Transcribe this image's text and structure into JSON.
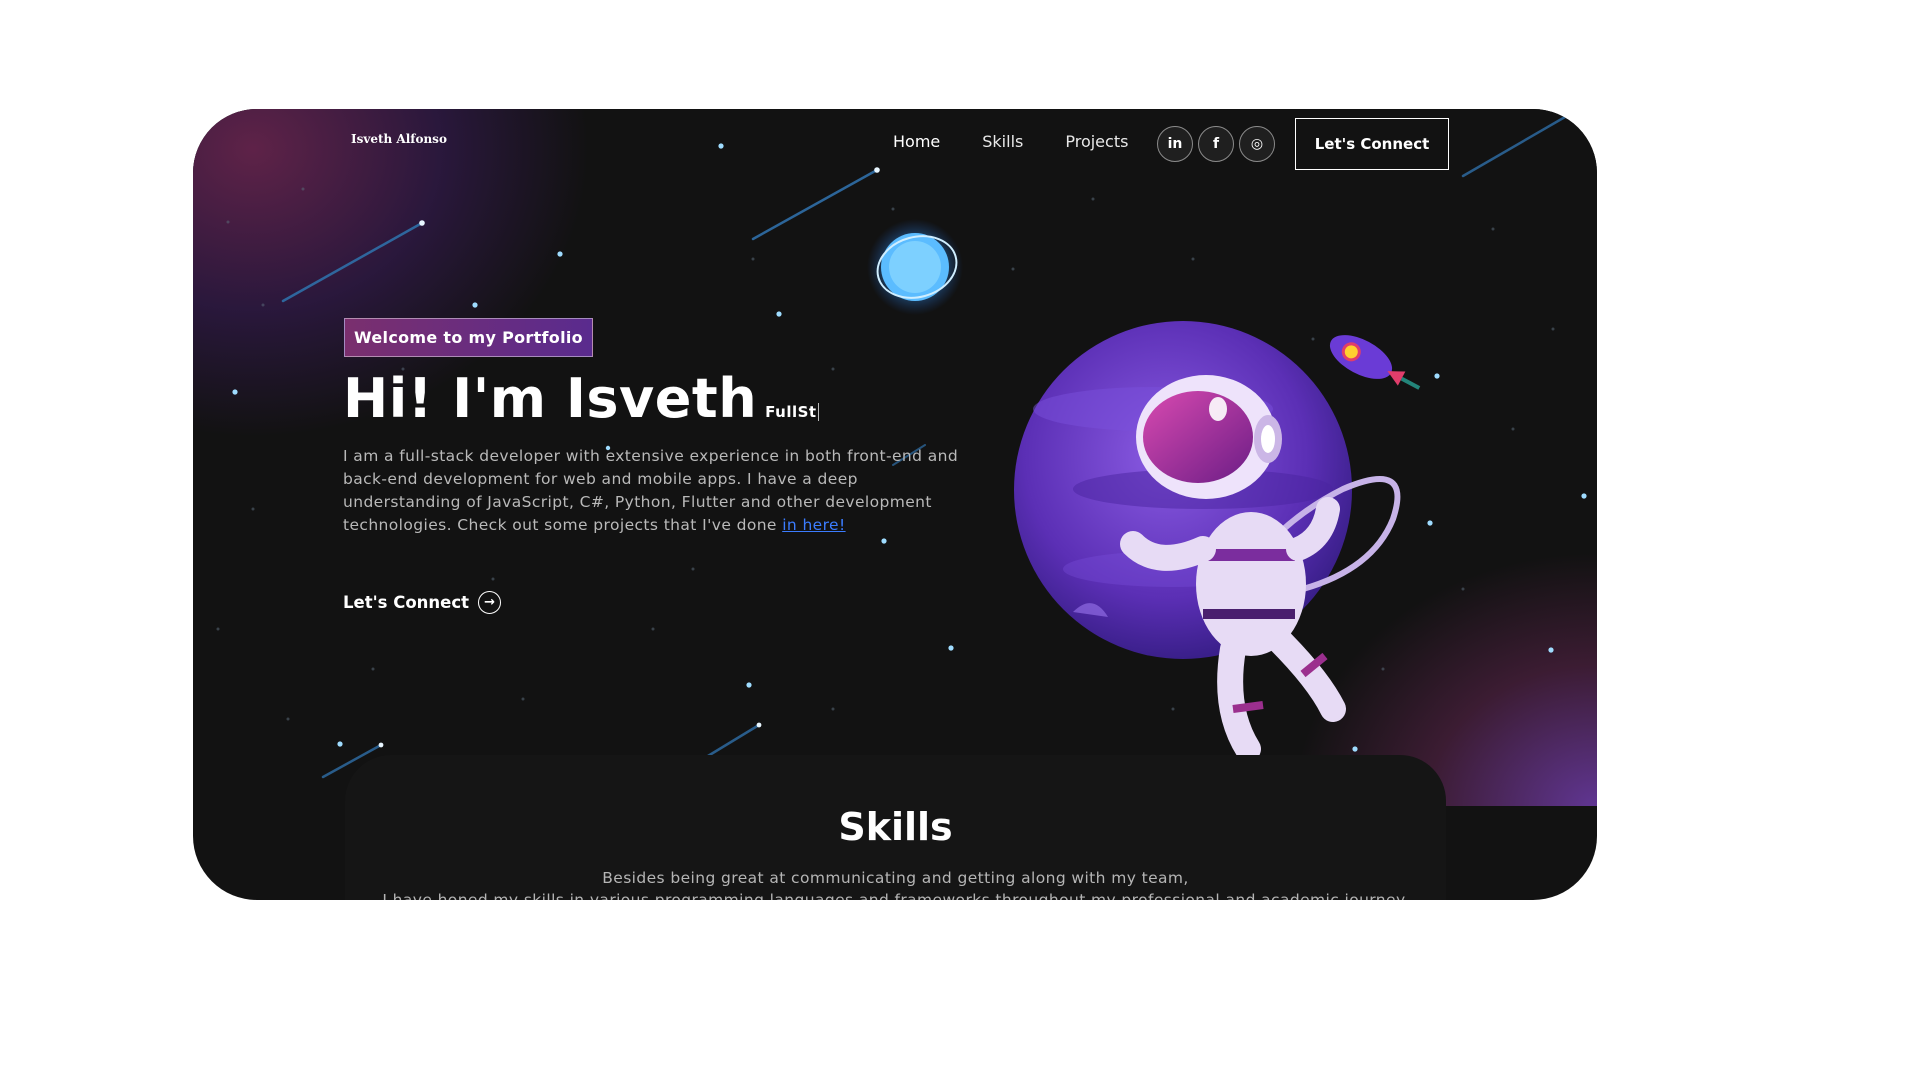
{
  "nav": {
    "logo": "Isveth Alfonso",
    "links": [
      "Home",
      "Skills",
      "Projects"
    ],
    "socials": [
      {
        "name": "linkedin-icon",
        "glyph": "in"
      },
      {
        "name": "facebook-icon",
        "glyph": "f"
      },
      {
        "name": "instagram-icon",
        "glyph": "◎"
      }
    ],
    "cta": "Let's Connect"
  },
  "hero": {
    "tagline": "Welcome to my Portfolio",
    "heading": "Hi! I'm Isveth",
    "rotating_text": "FullSt",
    "intro": "I am a full-stack developer with extensive experience in both front-end and back-end development for web and mobile apps. I have a deep understanding of JavaScript, C#, Python, Flutter and other development technologies. Check out some projects that I've done ",
    "intro_link": "in here!",
    "connect": "Let's Connect"
  },
  "skills": {
    "title": "Skills",
    "line1": "Besides being great at communicating and getting along with my team,",
    "line2": "I have honed my skills in various programming languages and frameworks throughout my professional and academic journey."
  },
  "colors": {
    "background": "#121212",
    "accent_purple": "#5a2b8e",
    "accent_magenta": "#7a2f6e",
    "link": "#3b7cff"
  }
}
